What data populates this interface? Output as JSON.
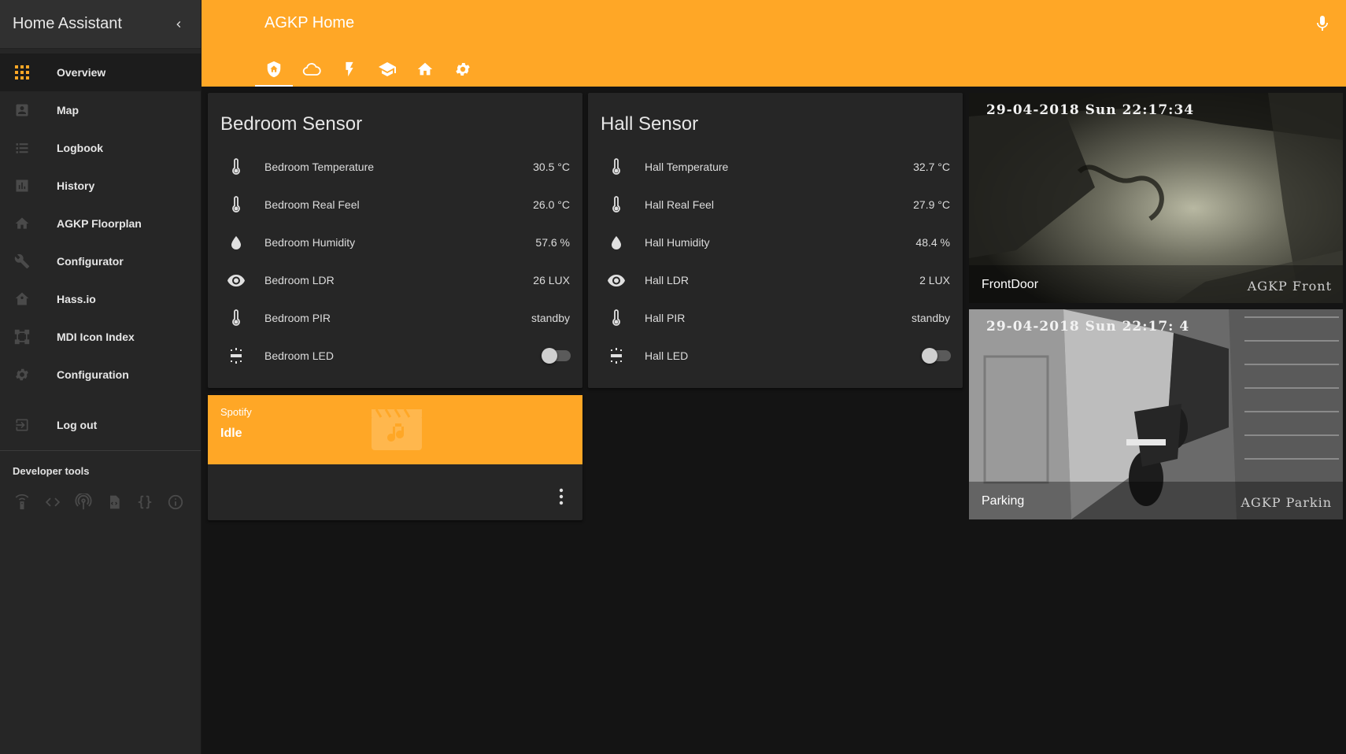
{
  "sidebar": {
    "title": "Home Assistant",
    "items": [
      {
        "label": "Overview",
        "icon": "view-dashboard-icon",
        "active": true
      },
      {
        "label": "Map",
        "icon": "account-box-icon"
      },
      {
        "label": "Logbook",
        "icon": "format-list-bulleted-icon"
      },
      {
        "label": "History",
        "icon": "poll-box-icon"
      },
      {
        "label": "AGKP Floorplan",
        "icon": "home-icon"
      },
      {
        "label": "Configurator",
        "icon": "wrench-icon"
      },
      {
        "label": "Hass.io",
        "icon": "home-assistant-icon"
      },
      {
        "label": "MDI Icon Index",
        "icon": "vector-square-icon"
      },
      {
        "label": "Configuration",
        "icon": "settings-icon"
      }
    ],
    "logout": "Log out",
    "developer_tools": {
      "title": "Developer tools",
      "icons": [
        "remote-icon",
        "code-tags-icon",
        "radio-tower-icon",
        "file-xml-icon",
        "code-braces-icon",
        "info-outline-icon"
      ]
    }
  },
  "header": {
    "title": "AGKP Home",
    "tabs": [
      "shield-home-icon",
      "cloud-outline-icon",
      "flash-icon",
      "school-icon",
      "home-icon",
      "settings-icon"
    ],
    "accent_color": "#ffa726"
  },
  "cards": {
    "bedroom": {
      "title": "Bedroom Sensor",
      "rows": [
        {
          "name": "Bedroom Temperature",
          "value": "30.5 °C",
          "icon": "thermometer-icon"
        },
        {
          "name": "Bedroom Real Feel",
          "value": "26.0 °C",
          "icon": "thermometer-icon"
        },
        {
          "name": "Bedroom Humidity",
          "value": "57.6 %",
          "icon": "water-icon"
        },
        {
          "name": "Bedroom LDR",
          "value": "26 LUX",
          "icon": "eye-icon"
        },
        {
          "name": "Bedroom PIR",
          "value": "standby",
          "icon": "thermometer-icon"
        },
        {
          "name": "Bedroom LED",
          "value": "off",
          "icon": "led-strip-icon"
        }
      ]
    },
    "hall": {
      "title": "Hall Sensor",
      "rows": [
        {
          "name": "Hall Temperature",
          "value": "32.7 °C",
          "icon": "thermometer-icon"
        },
        {
          "name": "Hall Real Feel",
          "value": "27.9 °C",
          "icon": "thermometer-icon"
        },
        {
          "name": "Hall Humidity",
          "value": "48.4 %",
          "icon": "water-icon"
        },
        {
          "name": "Hall LDR",
          "value": "2 LUX",
          "icon": "eye-icon"
        },
        {
          "name": "Hall PIR",
          "value": "standby",
          "icon": "thermometer-icon"
        },
        {
          "name": "Hall LED",
          "value": "off",
          "icon": "led-strip-icon"
        }
      ]
    },
    "media": {
      "source": "Spotify",
      "state": "Idle",
      "icon": "music-box-icon"
    },
    "cameras": [
      {
        "name": "FrontDoor",
        "timestamp": "29-04-2018 Sun 22:17:34",
        "watermark": "AGKP Front"
      },
      {
        "name": "Parking",
        "timestamp": "29-04-2018 Sun 22:17: 4",
        "watermark": "AGKP Parkin"
      }
    ]
  }
}
